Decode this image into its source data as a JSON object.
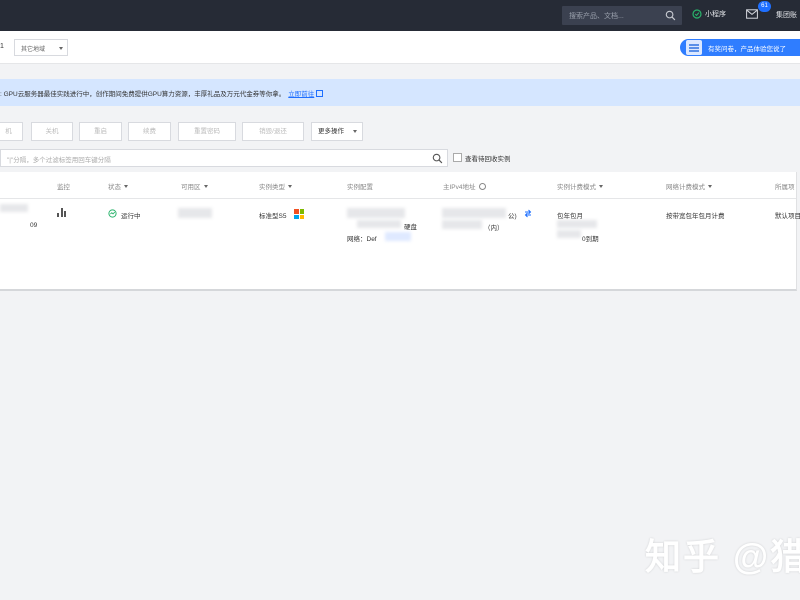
{
  "topbar": {
    "search_placeholder": "搜索产品、文档...",
    "mini_program": "小程序",
    "message_count": "61",
    "account": "集团账"
  },
  "region": {
    "number": "1",
    "select_label": "其它地域"
  },
  "survey": {
    "label": "有奖问卷，产品体验您说了"
  },
  "notice": {
    "text": ": GPU云服务器最佳实践进行中，创作期间免费提供GPU算力资源，丰厚礼品及万元代金券等你拿。",
    "link": "立即前往"
  },
  "toolbar": {
    "buttons": [
      "机",
      "关机",
      "重启",
      "续费",
      "重置密码",
      "销毁/退还"
    ],
    "more": "更多操作"
  },
  "filter": {
    "placeholder": "\"|\"分隔，多个过滤标签用回车键分隔",
    "recycle_label": "查看待回收实例"
  },
  "table": {
    "headers": {
      "monitor": "监控",
      "status": "状态",
      "zone": "可用区",
      "type": "实例类型",
      "config": "实例配置",
      "ip": "主IPv4地址",
      "billing": "实例计费模式",
      "net_billing": "网络计费模式",
      "project": "所属项"
    },
    "row": {
      "id_suffix": "09",
      "status": "运行中",
      "type": "标准型S5",
      "config_suffix": "硬盘",
      "network": "网络：Def",
      "ip_public": "公)",
      "ip_private": "（内）",
      "billing": "包年包月",
      "billing_time": "0到期",
      "net_billing": "按带宽包年包月计费",
      "project": "默认项目"
    }
  },
  "watermark": "知乎 @猎",
  "colors": {
    "topbar": "#262b36",
    "primary": "#1e6fff",
    "notice_bg": "#d5e6ff",
    "running": "#29b36b"
  }
}
